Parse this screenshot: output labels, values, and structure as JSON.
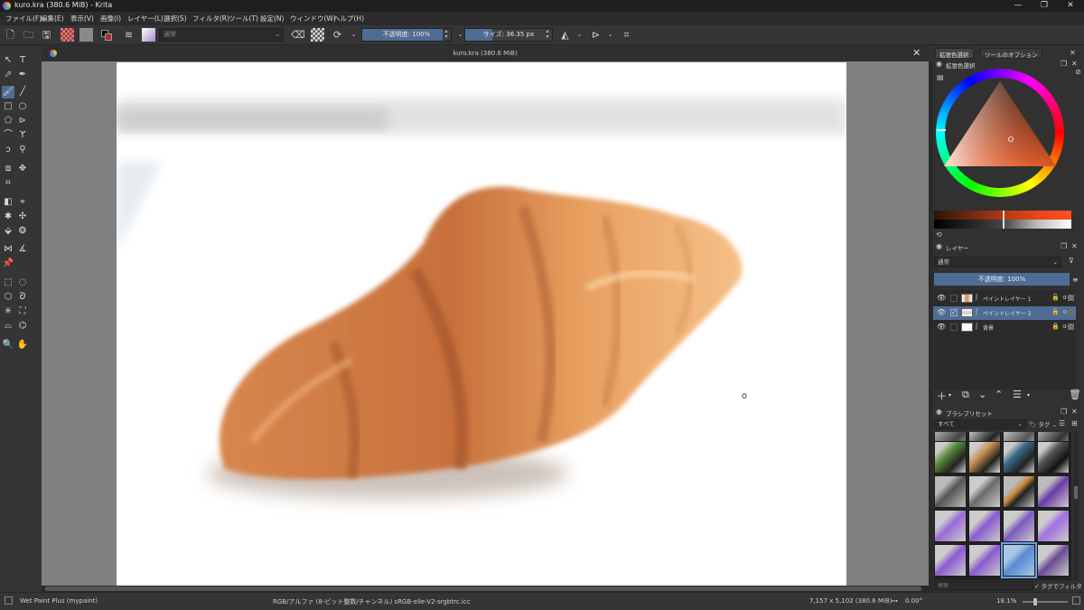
{
  "window": {
    "title": "kuro.kra (380.6 MiB)  - Krita",
    "minimize": "—",
    "maximize": "❐",
    "close": "✕"
  },
  "menu": [
    "ファイル(F)",
    "編集(E)",
    "表示(V)",
    "画像(I)",
    "レイヤー(L)",
    "選択(S)",
    "フィルタ(R)",
    "ツール(T)",
    "設定(N)",
    "ウィンドウ(W)",
    "ヘルプ(H)"
  ],
  "toolbar": {
    "blend_mode": "通常",
    "opacity_label": "不透明度: 100%",
    "opacity_value": 1.0,
    "size_label": "サイズ: 36.35 px",
    "size_fill": 0.33
  },
  "document": {
    "tab_title": "kuro.kra (380.6 MiB)",
    "close": "✕"
  },
  "docker_tabs": [
    "拡張色選択",
    "ツールのオプション"
  ],
  "color_selector": {
    "title": "拡張色選択",
    "current_color": "#b85a2a"
  },
  "layers": {
    "title": "レイヤー",
    "blend_mode": "通常",
    "opacity_label": "不透明度: 100%",
    "items": [
      {
        "name": "ペイントレイヤー 1",
        "checked": false
      },
      {
        "name": "ペイントレイヤー 2",
        "checked": true
      },
      {
        "name": "背景",
        "checked": false
      }
    ]
  },
  "brush_presets": {
    "title": "ブラシプリセット",
    "filter": "すべて",
    "tag_label": "タグ",
    "search_placeholder": "検索",
    "tag_filter_label": "タグでフィルタ"
  },
  "status": {
    "brush": "Wet Paint Plus (mypaint)",
    "color_info": "RGB/アルファ (8-ビット整数/チャンネル)  sRGB-elle-V2-srgbtrc.icc",
    "dimensions": "7,157 x 5,102 (380.6 MiB)",
    "rotation": "0.00°",
    "zoom": "18.1%"
  }
}
